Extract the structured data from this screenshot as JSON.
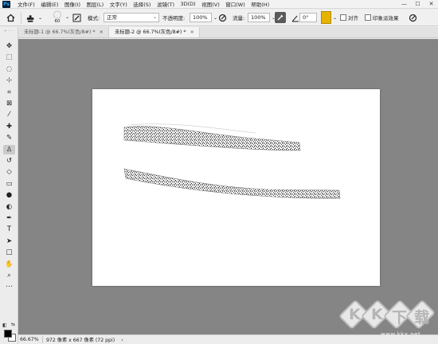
{
  "app": {
    "logo": "Ps",
    "menu": [
      "文件(F)",
      "编辑(E)",
      "图像(I)",
      "图层(L)",
      "文字(Y)",
      "选择(S)",
      "滤镜(T)",
      "3D(D)",
      "视图(V)",
      "窗口(W)",
      "帮助(H)"
    ],
    "window_controls": [
      "—",
      "☐",
      "✕"
    ]
  },
  "options": {
    "brush_size": "60",
    "mode_label": "模式:",
    "mode_value": "正常",
    "opacity_label": "不透明度:",
    "opacity_value": "100%",
    "flow_label": "流量:",
    "flow_value": "100%",
    "angle_value": "0°",
    "align_label": "对齐",
    "sample_label": "印象派效果"
  },
  "tabs": [
    {
      "label": "未标题-1 @ 66.7%(灰色/8#) *",
      "close": "×",
      "active": false
    },
    {
      "label": "未标题-2 @ 66.7%(灰色/8#) *",
      "close": "×",
      "active": true
    }
  ],
  "tools": [
    "move-icon",
    "marquee-icon",
    "lasso-icon",
    "quick-select-icon",
    "crop-icon",
    "frame-icon",
    "eyedropper-icon",
    "healing-brush-icon",
    "brush-icon",
    "clone-stamp-icon",
    "history-brush-icon",
    "eraser-icon",
    "gradient-icon",
    "blur-icon",
    "dodge-icon",
    "pen-icon",
    "type-icon",
    "path-select-icon",
    "rectangle-icon",
    "hand-icon",
    "zoom-icon",
    "more-tools-icon"
  ],
  "colors": {
    "foreground": "#000000",
    "background": "#ffffff",
    "workspace": "#858585"
  },
  "status": {
    "zoom": "66.67%",
    "doc_info": "972 像素 x 667 像素 (72 ppi)",
    "arrow": "›"
  },
  "watermark": {
    "letters": [
      "K",
      "K",
      "下",
      "载"
    ],
    "url": "www.kkx.net"
  }
}
